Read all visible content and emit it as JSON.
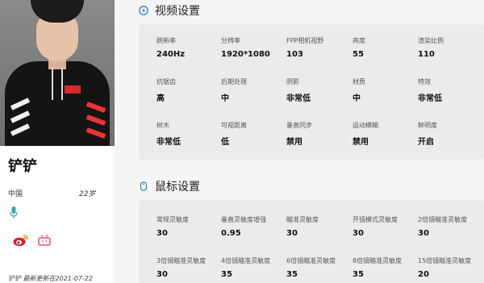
{
  "profile": {
    "name": "铲铲",
    "region": "中国",
    "age": "22岁",
    "updated": "铲铲 最新更新在2021-07-22"
  },
  "video_settings": {
    "title": "视频设置",
    "items": [
      {
        "label": "刷新率",
        "value": "240Hz"
      },
      {
        "label": "分辨率",
        "value": "1920*1080"
      },
      {
        "label": "FPP相机视野",
        "value": "103"
      },
      {
        "label": "亮度",
        "value": "55"
      },
      {
        "label": "渲染比例",
        "value": "110"
      },
      {
        "label": "抗锯齿",
        "value": "高"
      },
      {
        "label": "后期处理",
        "value": "中"
      },
      {
        "label": "阴影",
        "value": "非常低"
      },
      {
        "label": "材质",
        "value": "中"
      },
      {
        "label": "特效",
        "value": "非常低"
      },
      {
        "label": "树木",
        "value": "非常低"
      },
      {
        "label": "可视距离",
        "value": "低"
      },
      {
        "label": "垂直同步",
        "value": "禁用"
      },
      {
        "label": "运动模糊",
        "value": "禁用"
      },
      {
        "label": "鲜明度",
        "value": "开启"
      }
    ]
  },
  "mouse_settings": {
    "title": "鼠标设置",
    "items": [
      {
        "label": "常规灵敏度",
        "value": "30"
      },
      {
        "label": "垂直灵敏度增强",
        "value": "0.95"
      },
      {
        "label": "瞄准灵敏度",
        "value": "30"
      },
      {
        "label": "开镜模式灵敏度",
        "value": "30"
      },
      {
        "label": "2倍镜瞄准灵敏度",
        "value": "30"
      },
      {
        "label": "3倍镜瞄准灵敏度",
        "value": "30"
      },
      {
        "label": "4倍镜瞄准灵敏度",
        "value": "35"
      },
      {
        "label": "6倍镜瞄准灵敏度",
        "value": "35"
      },
      {
        "label": "8倍镜瞄准灵敏度",
        "value": "35"
      },
      {
        "label": "15倍镜瞄准灵敏度",
        "value": "20"
      }
    ]
  },
  "icons": {
    "video": "play-circle-icon",
    "mouse": "mouse-icon",
    "mic": "microphone-icon",
    "weibo": "weibo-icon",
    "bilibili": "bilibili-icon"
  },
  "colors": {
    "accent_blue": "#2b7fd4",
    "weibo_red": "#e6162d",
    "bilibili_pink": "#fb7299",
    "mic_teal": "#3aa6a6"
  }
}
